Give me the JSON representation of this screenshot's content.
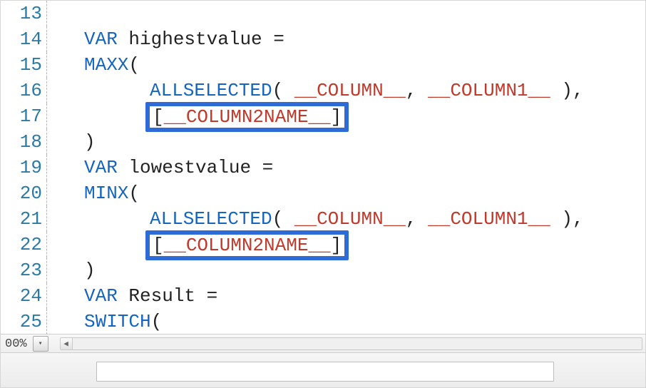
{
  "zoom": "00%",
  "gutter_start": 13,
  "lines": [
    {
      "n": "13",
      "tokens": []
    },
    {
      "n": "14",
      "tokens": [
        {
          "t": "pad-a"
        },
        {
          "cls": "kw",
          "txt": "VAR"
        },
        {
          "cls": "plain",
          "txt": " "
        },
        {
          "cls": "ident",
          "txt": "highestvalue"
        },
        {
          "cls": "plain",
          "txt": " = "
        }
      ]
    },
    {
      "n": "15",
      "tokens": [
        {
          "t": "pad-a"
        },
        {
          "cls": "fn",
          "txt": "MAXX"
        },
        {
          "cls": "punc",
          "txt": "("
        }
      ]
    },
    {
      "n": "16",
      "tokens": [
        {
          "t": "pad-b"
        },
        {
          "cls": "fn",
          "txt": "ALLSELECTED"
        },
        {
          "cls": "punc",
          "txt": "( "
        },
        {
          "cls": "placeholder",
          "txt": "__COLUMN__"
        },
        {
          "cls": "punc",
          "txt": ", "
        },
        {
          "cls": "placeholder",
          "txt": "__COLUMN1__"
        },
        {
          "cls": "punc",
          "txt": " ),"
        }
      ]
    },
    {
      "n": "17",
      "tokens": [
        {
          "t": "pad-b"
        },
        {
          "t": "hl",
          "inner": [
            {
              "cls": "punc",
              "txt": "["
            },
            {
              "cls": "placeholder",
              "txt": "__COLUMN2NAME__"
            },
            {
              "cls": "punc",
              "txt": "]"
            }
          ]
        }
      ]
    },
    {
      "n": "18",
      "tokens": [
        {
          "t": "pad-a"
        },
        {
          "cls": "punc",
          "txt": ")"
        }
      ]
    },
    {
      "n": "19",
      "tokens": [
        {
          "t": "pad-a"
        },
        {
          "cls": "kw",
          "txt": "VAR"
        },
        {
          "cls": "plain",
          "txt": " "
        },
        {
          "cls": "ident",
          "txt": "lowestvalue"
        },
        {
          "cls": "plain",
          "txt": " ="
        }
      ]
    },
    {
      "n": "20",
      "tokens": [
        {
          "t": "pad-a"
        },
        {
          "cls": "fn",
          "txt": "MINX"
        },
        {
          "cls": "punc",
          "txt": "("
        }
      ]
    },
    {
      "n": "21",
      "tokens": [
        {
          "t": "pad-b"
        },
        {
          "cls": "fn",
          "txt": "ALLSELECTED"
        },
        {
          "cls": "punc",
          "txt": "( "
        },
        {
          "cls": "placeholder",
          "txt": "__COLUMN__"
        },
        {
          "cls": "punc",
          "txt": ", "
        },
        {
          "cls": "placeholder",
          "txt": "__COLUMN1__"
        },
        {
          "cls": "punc",
          "txt": " ),"
        }
      ]
    },
    {
      "n": "22",
      "tokens": [
        {
          "t": "pad-b"
        },
        {
          "t": "hl",
          "inner": [
            {
              "cls": "punc",
              "txt": "["
            },
            {
              "cls": "placeholder",
              "txt": "__COLUMN2NAME__"
            },
            {
              "cls": "punc",
              "txt": "]"
            }
          ]
        }
      ]
    },
    {
      "n": "23",
      "tokens": [
        {
          "t": "pad-a"
        },
        {
          "cls": "punc",
          "txt": ")"
        }
      ]
    },
    {
      "n": "24",
      "tokens": [
        {
          "t": "pad-a"
        },
        {
          "cls": "kw",
          "txt": "VAR"
        },
        {
          "cls": "plain",
          "txt": " "
        },
        {
          "cls": "ident",
          "txt": "Result"
        },
        {
          "cls": "plain",
          "txt": " ="
        }
      ]
    },
    {
      "n": "25",
      "tokens": [
        {
          "t": "pad-a"
        },
        {
          "cls": "fn",
          "txt": "SWITCH"
        },
        {
          "cls": "punc",
          "txt": "("
        }
      ]
    }
  ]
}
